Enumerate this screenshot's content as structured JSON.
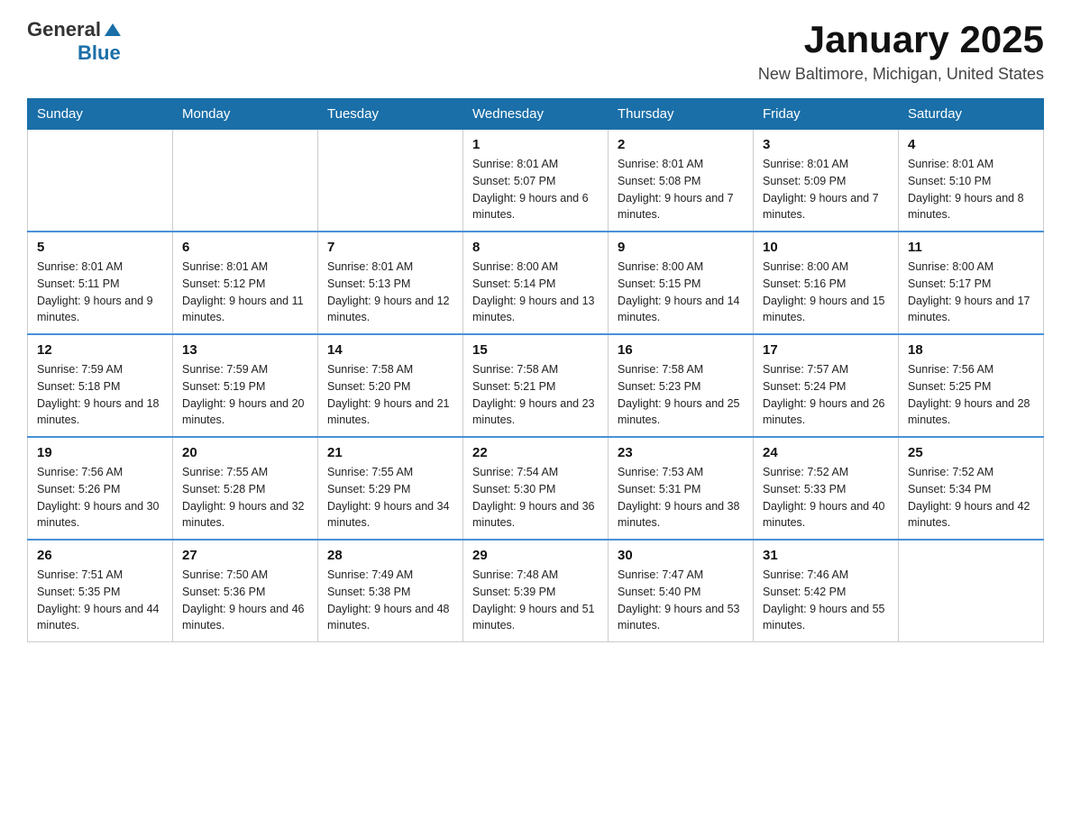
{
  "header": {
    "logo": {
      "general": "General",
      "blue": "Blue"
    },
    "title": "January 2025",
    "subtitle": "New Baltimore, Michigan, United States"
  },
  "days_of_week": [
    "Sunday",
    "Monday",
    "Tuesday",
    "Wednesday",
    "Thursday",
    "Friday",
    "Saturday"
  ],
  "weeks": [
    {
      "days": [
        {
          "num": "",
          "info": ""
        },
        {
          "num": "",
          "info": ""
        },
        {
          "num": "",
          "info": ""
        },
        {
          "num": "1",
          "info": "Sunrise: 8:01 AM\nSunset: 5:07 PM\nDaylight: 9 hours and 6 minutes."
        },
        {
          "num": "2",
          "info": "Sunrise: 8:01 AM\nSunset: 5:08 PM\nDaylight: 9 hours and 7 minutes."
        },
        {
          "num": "3",
          "info": "Sunrise: 8:01 AM\nSunset: 5:09 PM\nDaylight: 9 hours and 7 minutes."
        },
        {
          "num": "4",
          "info": "Sunrise: 8:01 AM\nSunset: 5:10 PM\nDaylight: 9 hours and 8 minutes."
        }
      ]
    },
    {
      "days": [
        {
          "num": "5",
          "info": "Sunrise: 8:01 AM\nSunset: 5:11 PM\nDaylight: 9 hours and 9 minutes."
        },
        {
          "num": "6",
          "info": "Sunrise: 8:01 AM\nSunset: 5:12 PM\nDaylight: 9 hours and 11 minutes."
        },
        {
          "num": "7",
          "info": "Sunrise: 8:01 AM\nSunset: 5:13 PM\nDaylight: 9 hours and 12 minutes."
        },
        {
          "num": "8",
          "info": "Sunrise: 8:00 AM\nSunset: 5:14 PM\nDaylight: 9 hours and 13 minutes."
        },
        {
          "num": "9",
          "info": "Sunrise: 8:00 AM\nSunset: 5:15 PM\nDaylight: 9 hours and 14 minutes."
        },
        {
          "num": "10",
          "info": "Sunrise: 8:00 AM\nSunset: 5:16 PM\nDaylight: 9 hours and 15 minutes."
        },
        {
          "num": "11",
          "info": "Sunrise: 8:00 AM\nSunset: 5:17 PM\nDaylight: 9 hours and 17 minutes."
        }
      ]
    },
    {
      "days": [
        {
          "num": "12",
          "info": "Sunrise: 7:59 AM\nSunset: 5:18 PM\nDaylight: 9 hours and 18 minutes."
        },
        {
          "num": "13",
          "info": "Sunrise: 7:59 AM\nSunset: 5:19 PM\nDaylight: 9 hours and 20 minutes."
        },
        {
          "num": "14",
          "info": "Sunrise: 7:58 AM\nSunset: 5:20 PM\nDaylight: 9 hours and 21 minutes."
        },
        {
          "num": "15",
          "info": "Sunrise: 7:58 AM\nSunset: 5:21 PM\nDaylight: 9 hours and 23 minutes."
        },
        {
          "num": "16",
          "info": "Sunrise: 7:58 AM\nSunset: 5:23 PM\nDaylight: 9 hours and 25 minutes."
        },
        {
          "num": "17",
          "info": "Sunrise: 7:57 AM\nSunset: 5:24 PM\nDaylight: 9 hours and 26 minutes."
        },
        {
          "num": "18",
          "info": "Sunrise: 7:56 AM\nSunset: 5:25 PM\nDaylight: 9 hours and 28 minutes."
        }
      ]
    },
    {
      "days": [
        {
          "num": "19",
          "info": "Sunrise: 7:56 AM\nSunset: 5:26 PM\nDaylight: 9 hours and 30 minutes."
        },
        {
          "num": "20",
          "info": "Sunrise: 7:55 AM\nSunset: 5:28 PM\nDaylight: 9 hours and 32 minutes."
        },
        {
          "num": "21",
          "info": "Sunrise: 7:55 AM\nSunset: 5:29 PM\nDaylight: 9 hours and 34 minutes."
        },
        {
          "num": "22",
          "info": "Sunrise: 7:54 AM\nSunset: 5:30 PM\nDaylight: 9 hours and 36 minutes."
        },
        {
          "num": "23",
          "info": "Sunrise: 7:53 AM\nSunset: 5:31 PM\nDaylight: 9 hours and 38 minutes."
        },
        {
          "num": "24",
          "info": "Sunrise: 7:52 AM\nSunset: 5:33 PM\nDaylight: 9 hours and 40 minutes."
        },
        {
          "num": "25",
          "info": "Sunrise: 7:52 AM\nSunset: 5:34 PM\nDaylight: 9 hours and 42 minutes."
        }
      ]
    },
    {
      "days": [
        {
          "num": "26",
          "info": "Sunrise: 7:51 AM\nSunset: 5:35 PM\nDaylight: 9 hours and 44 minutes."
        },
        {
          "num": "27",
          "info": "Sunrise: 7:50 AM\nSunset: 5:36 PM\nDaylight: 9 hours and 46 minutes."
        },
        {
          "num": "28",
          "info": "Sunrise: 7:49 AM\nSunset: 5:38 PM\nDaylight: 9 hours and 48 minutes."
        },
        {
          "num": "29",
          "info": "Sunrise: 7:48 AM\nSunset: 5:39 PM\nDaylight: 9 hours and 51 minutes."
        },
        {
          "num": "30",
          "info": "Sunrise: 7:47 AM\nSunset: 5:40 PM\nDaylight: 9 hours and 53 minutes."
        },
        {
          "num": "31",
          "info": "Sunrise: 7:46 AM\nSunset: 5:42 PM\nDaylight: 9 hours and 55 minutes."
        },
        {
          "num": "",
          "info": ""
        }
      ]
    }
  ]
}
